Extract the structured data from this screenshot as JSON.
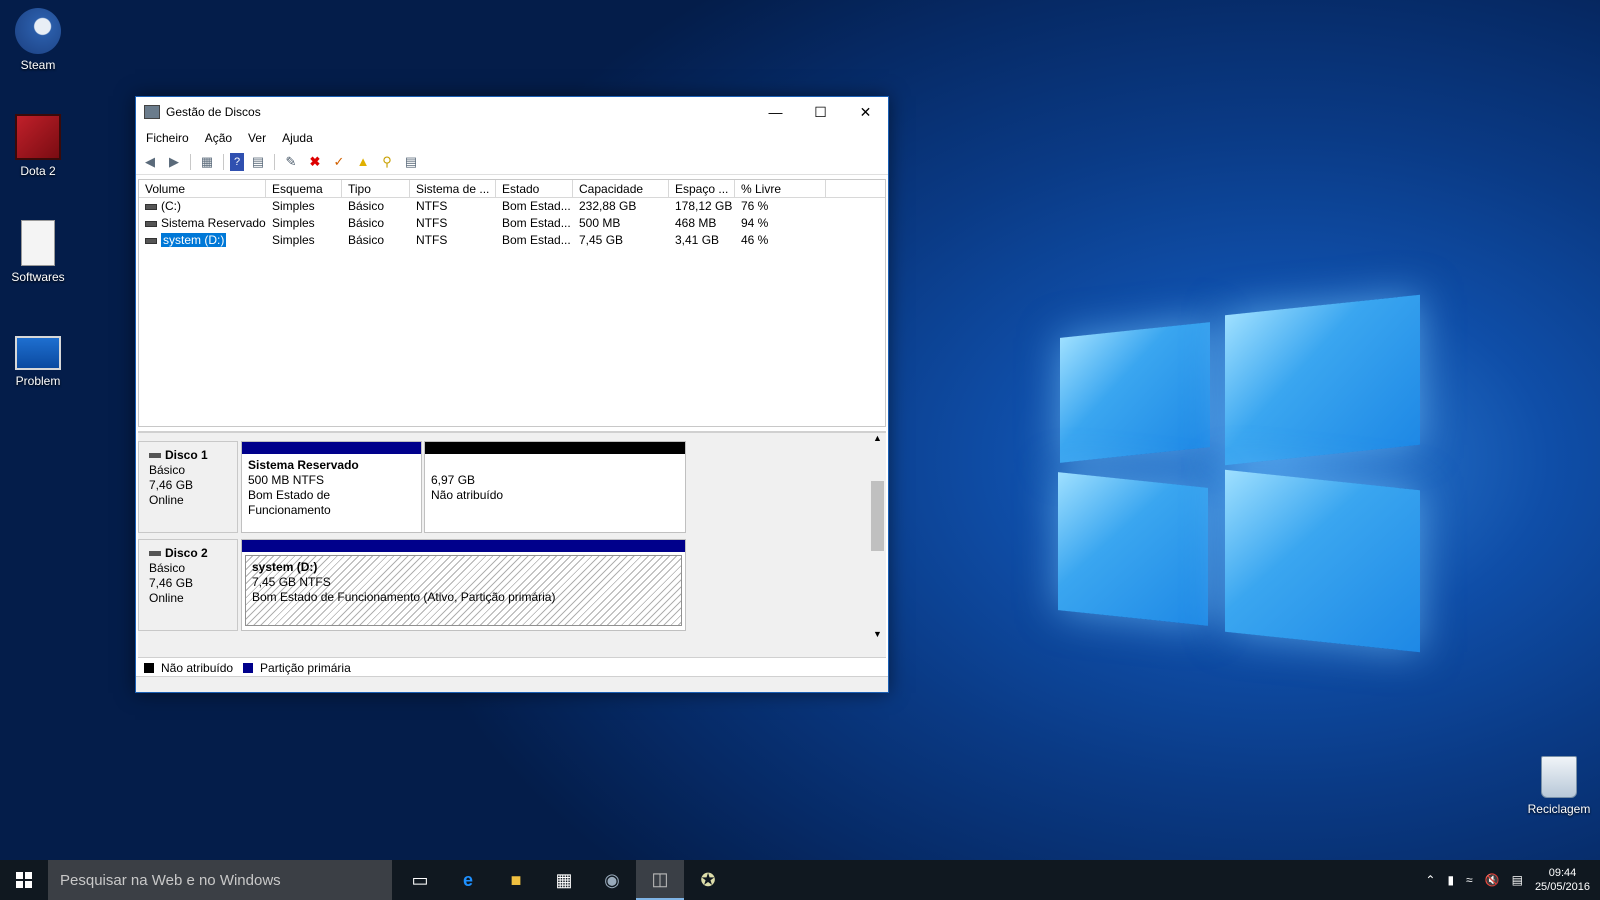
{
  "desktop": {
    "icons": [
      {
        "label": "Steam",
        "icon": "steam-icon"
      },
      {
        "label": "Dota 2",
        "icon": "dota-icon"
      },
      {
        "label": "Softwares",
        "icon": "document-icon"
      },
      {
        "label": "Problem",
        "icon": "screen-icon"
      },
      {
        "label": "Reciclagem",
        "icon": "recycle-bin-icon"
      }
    ]
  },
  "window": {
    "title": "Gestão de Discos",
    "menu": [
      "Ficheiro",
      "Ação",
      "Ver",
      "Ajuda"
    ],
    "columns": [
      "Volume",
      "Esquema",
      "Tipo",
      "Sistema de ...",
      "Estado",
      "Capacidade",
      "Espaço ...",
      "% Livre"
    ],
    "rows": [
      {
        "volume": "(C:)",
        "esquema": "Simples",
        "tipo": "Básico",
        "sistema": "NTFS",
        "estado": "Bom Estad...",
        "capacidade": "232,88 GB",
        "espaco": "178,12 GB",
        "livre": "76 %"
      },
      {
        "volume": "Sistema Reservado",
        "esquema": "Simples",
        "tipo": "Básico",
        "sistema": "NTFS",
        "estado": "Bom Estad...",
        "capacidade": "500 MB",
        "espaco": "468 MB",
        "livre": "94 %"
      },
      {
        "volume": "system (D:)",
        "esquema": "Simples",
        "tipo": "Básico",
        "sistema": "NTFS",
        "estado": "Bom Estad...",
        "capacidade": "7,45 GB",
        "espaco": "3,41 GB",
        "livre": "46 %"
      }
    ],
    "disks": [
      {
        "name": "Disco 1",
        "type": "Básico",
        "size": "7,46 GB",
        "status": "Online",
        "partitions": [
          {
            "title": "Sistema Reservado",
            "size": "500 MB NTFS",
            "state": "Bom Estado de Funcionamento"
          },
          {
            "title": "",
            "size": "6,97 GB",
            "state": "Não atribuído"
          }
        ]
      },
      {
        "name": "Disco 2",
        "type": "Básico",
        "size": "7,46 GB",
        "status": "Online",
        "partitions": [
          {
            "title": "system  (D:)",
            "size": "7,45 GB NTFS",
            "state": "Bom Estado de Funcionamento (Ativo, Partição primária)"
          }
        ]
      }
    ],
    "legend": {
      "unallocated": "Não atribuído",
      "primary": "Partição primária"
    }
  },
  "taskbar": {
    "search_placeholder": "Pesquisar na Web e no Windows",
    "time": "09:44",
    "date": "25/05/2016"
  },
  "colors": {
    "primary_partition": "#00008b",
    "unallocated": "#000000",
    "selection": "#0078d7"
  }
}
